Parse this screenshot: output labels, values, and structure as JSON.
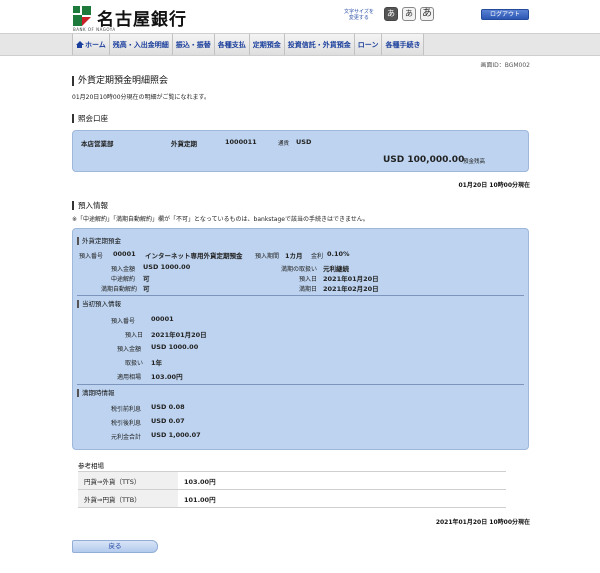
{
  "header": {
    "bank_name": "名古屋銀行",
    "bank_sub": "BANK OF NAGOYA",
    "font_size_label_line1": "文字サイズを",
    "font_size_label_line2": "変更する",
    "font_sizes": [
      "あ",
      "あ",
      "あ"
    ],
    "logout_label": "ログアウト",
    "brand_color": "#1e7a3a"
  },
  "nav": {
    "items": [
      "ホーム",
      "残高・入出金明細",
      "振込・振替",
      "各種支払",
      "定期預金",
      "投資信託・外貨預金",
      "ローン",
      "各種手続き"
    ]
  },
  "screen_id": "画面ID：BGM002",
  "page": {
    "title": "外貨定期預金明細照会",
    "note": "01月20日10時00分現在の明細がご覧になれます。"
  },
  "account": {
    "section_title": "照会口座",
    "branch": "本店営業部",
    "type": "外貨定期",
    "number": "1000011",
    "currency_label": "通貨",
    "currency": "USD",
    "balance": "USD 100,000.00",
    "balance_label": "預金残高",
    "as_of": "01月20日 10時00分現在"
  },
  "deposit": {
    "section_title": "預入情報",
    "note": "※「中途解約」「満期自動解約」欄が「不可」となっているものは、bankstageで該当の手続きはできません。",
    "fx_time_deposit": {
      "title": "外貨定期預金",
      "no_label": "預入番号",
      "no": "00001",
      "product": "インターネット専用外貨定期預金",
      "period_label": "預入期間",
      "period": "1カ月",
      "rate_label": "金利",
      "rate": "0.10%",
      "amount_label": "預入金額",
      "amount": "USD 1000.00",
      "maturity_handling_label": "満期の取扱い",
      "maturity_handling": "元利継続",
      "early_cancel_label": "中途解約",
      "early_cancel": "可",
      "deposit_date_label": "預入日",
      "deposit_date": "2021年01月20日",
      "auto_cancel_label": "満期自動解約",
      "auto_cancel": "可",
      "maturity_date_label": "満期日",
      "maturity_date": "2021年02月20日"
    },
    "initial": {
      "title": "当初預入情報",
      "no_label": "預入番号",
      "no": "00001",
      "date_label": "預入日",
      "date": "2021年01月20日",
      "amount_label": "預入金額",
      "amount": "USD 1000.00",
      "handling_label": "取扱い",
      "handling": "1年",
      "rate_label": "適用相場",
      "rate": "103.00円"
    },
    "maturity": {
      "title": "満期時情報",
      "pre_tax_label": "税引前利息",
      "pre_tax": "USD 0.08",
      "post_tax_label": "税引後利息",
      "post_tax": "USD 0.07",
      "total_label": "元利金合計",
      "total": "USD 1,000.07"
    }
  },
  "reference": {
    "title": "参考相場",
    "rows": [
      {
        "label": "円貨⇒外貨（TTS）",
        "value": "103.00円"
      },
      {
        "label": "外貨⇒円貨（TTB）",
        "value": "101.00円"
      }
    ],
    "as_of": "2021年01月20日 10時00分現在"
  },
  "back_label": "戻る"
}
